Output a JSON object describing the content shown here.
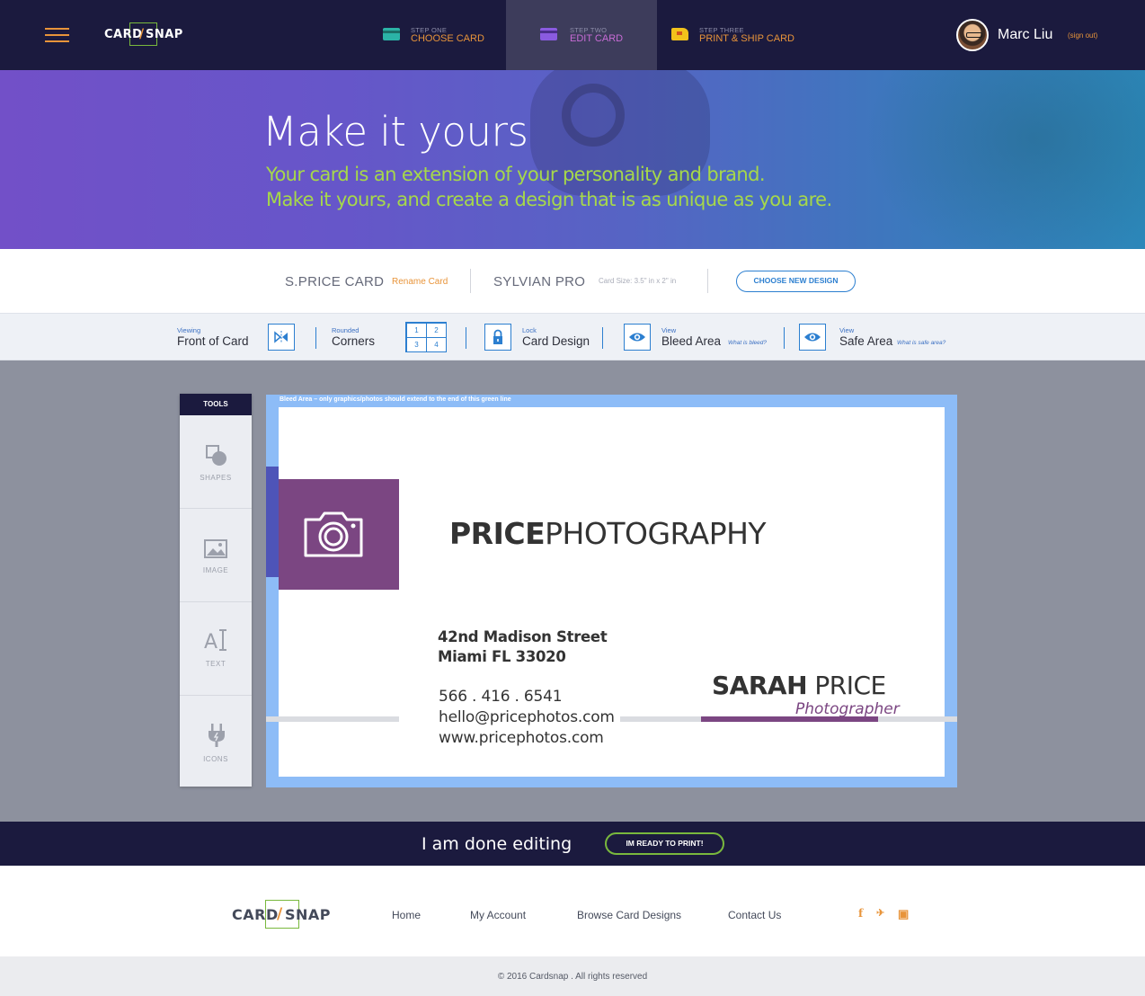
{
  "brand": {
    "logo_left": "CARD",
    "logo_bolt": "/",
    "logo_right": "SNAP"
  },
  "nav": {
    "steps": [
      {
        "num": "STEP ONE",
        "title": "CHOOSE CARD",
        "icon": "card-icon",
        "color": "#2bb3a6"
      },
      {
        "num": "STEP TWO",
        "title": "EDIT CARD",
        "icon": "edit-card-icon",
        "color": "#8a5be0",
        "active": true
      },
      {
        "num": "STEP THREE",
        "title": "PRINT & SHIP CARD",
        "icon": "truck-icon",
        "color": "#f2c21b"
      }
    ],
    "user_name": "Marc Liu",
    "sign_out": "(sign out)"
  },
  "hero": {
    "title": "Make it yours",
    "subtitle_1": "Your card is an extension of your personality and brand.",
    "subtitle_2": "Make it yours, and create a design that is as unique as you are."
  },
  "card_info": {
    "card_name": "S.PRICE CARD",
    "rename": "Rename Card",
    "design_name": "SYLVIAN PRO",
    "card_size": "Card Size: 3.5\" in x 2\" in",
    "choose_btn": "CHOOSE NEW DESIGN"
  },
  "options": {
    "viewing_label": "Viewing",
    "viewing_value": "Front of Card",
    "rounded_label": "Rounded",
    "rounded_value": "Corners",
    "corners": [
      "1",
      "2",
      "3",
      "4"
    ],
    "lock_label": "Lock",
    "lock_value": "Card Design",
    "bleed_label": "View",
    "bleed_value": "Bleed Area",
    "bleed_link": "What is bleed?",
    "safe_label": "View",
    "safe_value": "Safe Area",
    "safe_link": "What is safe area?"
  },
  "tools": {
    "header": "TOOLS",
    "items": [
      {
        "label": "SHAPES",
        "icon": "shapes-icon"
      },
      {
        "label": "IMAGE",
        "icon": "image-icon"
      },
      {
        "label": "TEXT",
        "icon": "text-icon"
      },
      {
        "label": "ICONS",
        "icon": "plug-icon"
      }
    ]
  },
  "canvas": {
    "bleed_note": "Bleed Area – only graphics/photos should extend to the end of this green line",
    "brand_bold": "PRICE",
    "brand_light": "PHOTOGRAPHY",
    "address_1": "42nd Madison Street",
    "address_2": "Miami FL 33020",
    "phone": "566 . 416 . 6541",
    "email": "hello@pricephotos.com",
    "website": "www.pricephotos.com",
    "first_name": "SARAH",
    "last_name": "PRICE",
    "role": "Photographer"
  },
  "done_bar": {
    "text": "I am done editing",
    "button": "IM READY TO PRINT!"
  },
  "footer": {
    "links": [
      "Home",
      "My Account",
      "Browse Card Designs",
      "Contact Us"
    ],
    "social": [
      {
        "icon": "facebook-icon",
        "glyph": "f"
      },
      {
        "icon": "twitter-icon",
        "glyph": "✈"
      },
      {
        "icon": "instagram-icon",
        "glyph": "▣"
      }
    ],
    "copyright": "© 2016 Cardsnap . All rights reserved"
  },
  "colors": {
    "nav_bg": "#1b1a3e",
    "accent_orange": "#e8943a",
    "accent_green": "#79b83d",
    "accent_blue": "#2c7fd0",
    "brand_purple": "#7b4682"
  }
}
